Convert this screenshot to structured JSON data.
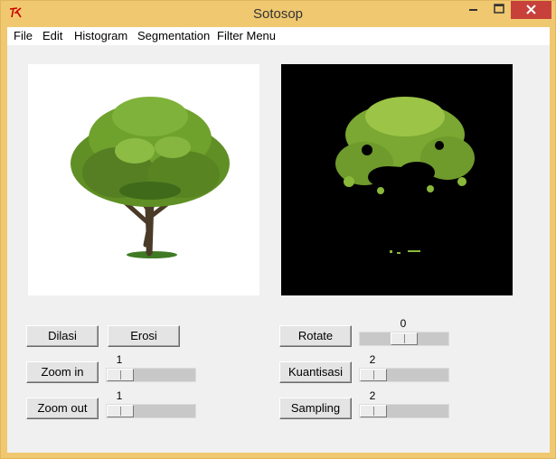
{
  "window": {
    "title": "Sotosop"
  },
  "menu": [
    "File",
    "Edit",
    "Histogram",
    "Segmentation",
    "Filter Menu"
  ],
  "buttons": {
    "dilasi": "Dilasi",
    "erosi": "Erosi",
    "zoom_in": "Zoom in",
    "zoom_out": "Zoom out",
    "rotate": "Rotate",
    "kuantisasi": "Kuantisasi",
    "sampling": "Sampling"
  },
  "scales": {
    "zoom_in": {
      "value": "1",
      "fraction": 0.0
    },
    "zoom_out": {
      "value": "1",
      "fraction": 0.0
    },
    "rotate": {
      "value": "0",
      "fraction": 0.5
    },
    "kuantisasi": {
      "value": "2",
      "fraction": 0.0
    },
    "sampling": {
      "value": "2",
      "fraction": 0.0
    }
  },
  "images": {
    "original": "tree-image",
    "segmented": "segmented-tree-image"
  },
  "colors": {
    "titlebar": "#f0c870",
    "close": "#c7413a",
    "canopy": "#6b9a2a",
    "segment_canopy": "#8ab83a"
  }
}
